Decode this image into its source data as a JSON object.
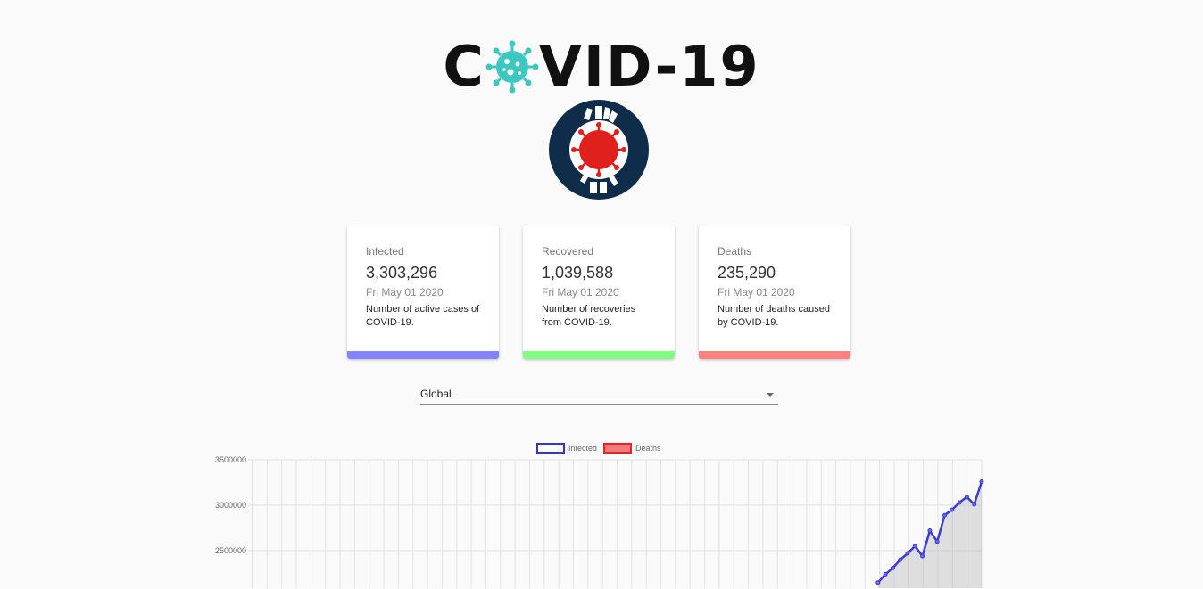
{
  "header": {
    "title_left": "C",
    "title_right": "VID-19",
    "logo_icon": "coronavirus-icon",
    "badge_icon": "stay-home-badge"
  },
  "cards": [
    {
      "label": "Infected",
      "value": "3,303,296",
      "date": "Fri May 01 2020",
      "desc": "Number of active cases of COVID-19.",
      "color": "#8484ff"
    },
    {
      "label": "Recovered",
      "value": "1,039,588",
      "date": "Fri May 01 2020",
      "desc": "Number of recoveries from COVID-19.",
      "color": "#80ff80"
    },
    {
      "label": "Deaths",
      "value": "235,290",
      "date": "Fri May 01 2020",
      "desc": "Number of deaths caused by COVID-19.",
      "color": "#ff8080"
    }
  ],
  "country_select": {
    "value": "Global"
  },
  "chart_data": {
    "type": "line",
    "legend": [
      {
        "name": "Infected",
        "color": "#3333dd",
        "fill": "rgba(0,0,0,0)"
      },
      {
        "name": "Deaths",
        "color": "#ee2222",
        "fill": "rgba(240,80,80,0.75)"
      }
    ],
    "yticks": [
      3500000,
      3000000,
      2500000
    ],
    "ylim": [
      2150000,
      3500000
    ],
    "grid": true,
    "series": [
      {
        "name": "Infected",
        "values": [
          2150000,
          2240000,
          2310000,
          2400000,
          2470000,
          2550000,
          2440000,
          2720000,
          2600000,
          2890000,
          2950000,
          3030000,
          3090000,
          3010000,
          3260000
        ]
      }
    ]
  }
}
